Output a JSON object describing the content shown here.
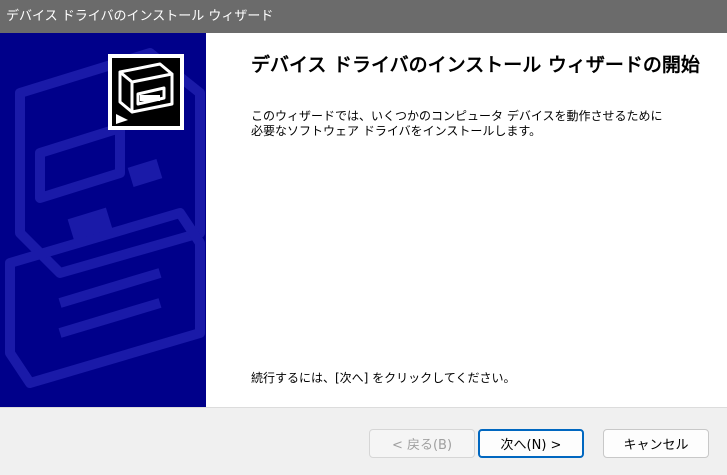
{
  "window": {
    "title": "デバイス ドライバのインストール ウィザード"
  },
  "content": {
    "heading": "デバイス ドライバのインストール ウィザードの開始",
    "description_lines": [
      "このウィザードでは、いくつかのコンピュータ デバイスを動作させるために",
      "必要なソフトウェア ドライバをインストールします。"
    ],
    "continue_text": "続行するには、[次へ] をクリックしてください。"
  },
  "buttons": {
    "back": "< 戻る(B)",
    "next": "次へ(N) >",
    "cancel": "キャンセル"
  },
  "icons": {
    "wizard": "hardware-install-icon"
  },
  "colors": {
    "side_panel": "#00008a",
    "titlebar": "#6b6b6b",
    "accent": "#0067c0"
  }
}
